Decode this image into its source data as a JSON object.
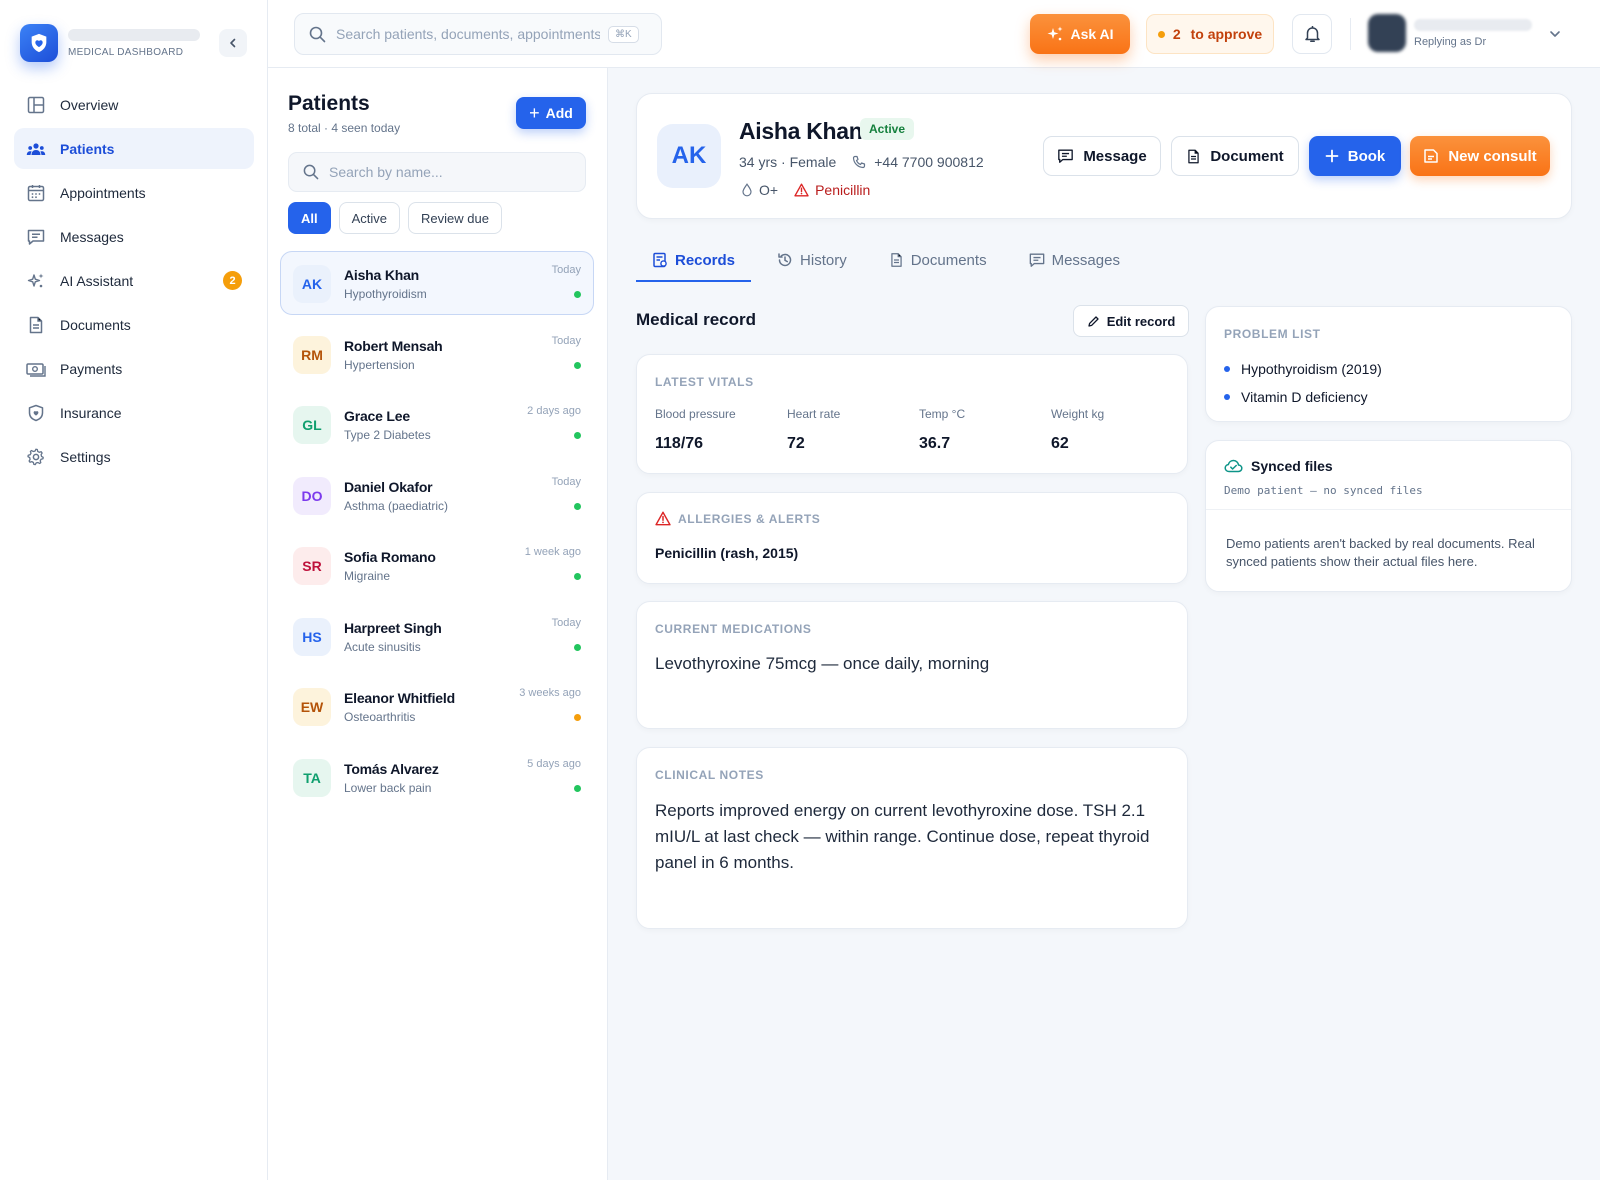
{
  "app": {
    "brand_sub": "MEDICAL DASHBOARD"
  },
  "nav": {
    "items": [
      {
        "label": "Overview",
        "icon": "layout-icon"
      },
      {
        "label": "Patients",
        "icon": "users-icon",
        "active": true
      },
      {
        "label": "Appointments",
        "icon": "calendar-icon"
      },
      {
        "label": "Messages",
        "icon": "message-icon"
      },
      {
        "label": "AI Assistant",
        "icon": "sparkle-icon",
        "badge": "2"
      },
      {
        "label": "Documents",
        "icon": "document-icon"
      },
      {
        "label": "Payments",
        "icon": "payment-icon"
      },
      {
        "label": "Insurance",
        "icon": "shield-icon"
      },
      {
        "label": "Settings",
        "icon": "gear-icon"
      }
    ]
  },
  "topbar": {
    "search_placeholder": "Search patients, documents, appointments",
    "shortcut": "⌘K",
    "ask_ai": "Ask AI",
    "approve_count": "2",
    "approve_label": "to approve",
    "user_role": "Replying as Dr"
  },
  "patients_panel": {
    "title": "Patients",
    "subtitle": "8 total · 4 seen today",
    "add_label": "Add",
    "search_placeholder": "Search by name...",
    "filters": [
      "All",
      "Active",
      "Review due"
    ],
    "items": [
      {
        "initials": "AK",
        "name": "Aisha Khan",
        "condition": "Hypothyroidism",
        "when": "Today",
        "status_color": "#22c55e",
        "avatar_bg": "#eaf1fc",
        "avatar_fg": "#2563eb"
      },
      {
        "initials": "RM",
        "name": "Robert Mensah",
        "condition": "Hypertension",
        "when": "Today",
        "status_color": "#22c55e",
        "avatar_bg": "#fdf3dc",
        "avatar_fg": "#b45309"
      },
      {
        "initials": "GL",
        "name": "Grace Lee",
        "condition": "Type 2 Diabetes",
        "when": "2 days ago",
        "status_color": "#22c55e",
        "avatar_bg": "#e6f6ef",
        "avatar_fg": "#0f9f6e"
      },
      {
        "initials": "DO",
        "name": "Daniel Okafor",
        "condition": "Asthma (paediatric)",
        "when": "Today",
        "status_color": "#22c55e",
        "avatar_bg": "#f1ebfd",
        "avatar_fg": "#7c3aed"
      },
      {
        "initials": "SR",
        "name": "Sofia Romano",
        "condition": "Migraine",
        "when": "1 week ago",
        "status_color": "#22c55e",
        "avatar_bg": "#fdecec",
        "avatar_fg": "#be123c"
      },
      {
        "initials": "HS",
        "name": "Harpreet Singh",
        "condition": "Acute sinusitis",
        "when": "Today",
        "status_color": "#22c55e",
        "avatar_bg": "#eaf1fc",
        "avatar_fg": "#2563eb"
      },
      {
        "initials": "EW",
        "name": "Eleanor Whitfield",
        "condition": "Osteoarthritis",
        "when": "3 weeks ago",
        "status_color": "#f59e0b",
        "avatar_bg": "#fdf3dc",
        "avatar_fg": "#b45309"
      },
      {
        "initials": "TA",
        "name": "Tomás Alvarez",
        "condition": "Lower back pain",
        "when": "5 days ago",
        "status_color": "#22c55e",
        "avatar_bg": "#e6f6ef",
        "avatar_fg": "#0f9f6e"
      }
    ]
  },
  "patient": {
    "initials": "AK",
    "name": "Aisha Khan",
    "status": "Active",
    "age_sex": "34 yrs · Female",
    "phone": "+44 7700 900812",
    "blood_type": "O+",
    "allergy_tag": "Penicillin",
    "actions": {
      "message": "Message",
      "document": "Document",
      "book": "Book",
      "new_consult": "New consult"
    }
  },
  "tabs": [
    "Records",
    "History",
    "Documents",
    "Messages"
  ],
  "record": {
    "title": "Medical record",
    "edit_label": "Edit record",
    "vitals_caption": "LATEST VITALS",
    "vitals": [
      {
        "label": "Blood pressure",
        "value": "118/76"
      },
      {
        "label": "Heart rate",
        "value": "72"
      },
      {
        "label": "Temp °C",
        "value": "36.7"
      },
      {
        "label": "Weight kg",
        "value": "62"
      }
    ],
    "allergies_caption": "ALLERGIES & ALERTS",
    "allergies": "Penicillin (rash, 2015)",
    "medications_caption": "CURRENT MEDICATIONS",
    "medications": "Levothyroxine 75mcg — once daily, morning",
    "notes_caption": "CLINICAL NOTES",
    "notes": "Reports improved energy on current levothyroxine dose. TSH 2.1 mIU/L at last check — within range. Continue dose, repeat thyroid panel in 6 months."
  },
  "problems": {
    "caption": "PROBLEM LIST",
    "items": [
      "Hypothyroidism (2019)",
      "Vitamin D deficiency"
    ]
  },
  "synced": {
    "title": "Synced files",
    "subtitle": "Demo patient — no synced files",
    "body": "Demo patients aren't backed by real documents. Real synced patients show their actual files here."
  },
  "colors": {
    "primary": "#2563eb",
    "accent_orange": "#f97316",
    "danger": "#b91c1c",
    "success": "#15803d"
  }
}
